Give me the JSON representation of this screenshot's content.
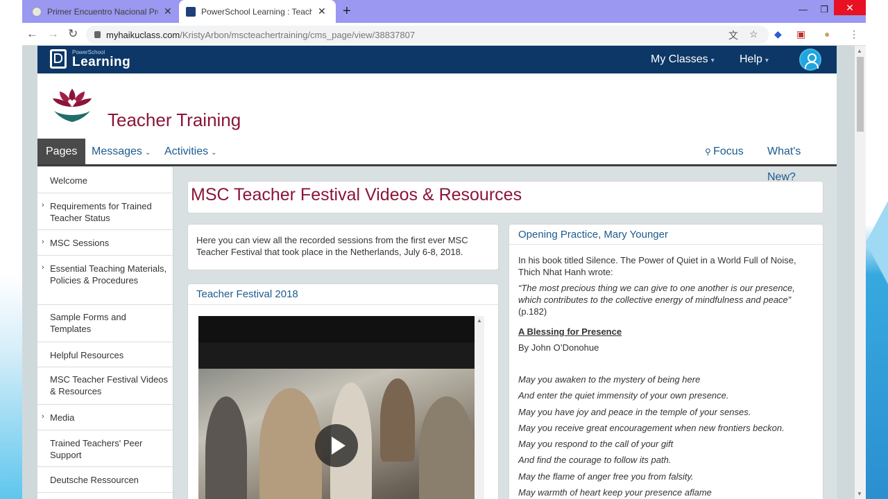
{
  "browser": {
    "tabs": [
      {
        "title": "Primer Encuentro Nacional Profe",
        "active": false
      },
      {
        "title": "PowerSchool Learning : Teacher",
        "active": true
      }
    ],
    "url_host": "myhaikuclass.com",
    "url_path": "/KristyArbon/mscteachertraining/cms_page/view/38837807"
  },
  "ps_header": {
    "logo_small": "PowerSchool",
    "logo_big": "Learning",
    "menu_my_classes": "My Classes",
    "menu_help": "Help"
  },
  "class": {
    "title": "Teacher Training"
  },
  "nav": {
    "pages": "Pages",
    "messages": "Messages",
    "activities": "Activities",
    "focus": "Focus",
    "whats_new": "What's New?"
  },
  "sidebar": {
    "items": [
      {
        "label": "Welcome",
        "expandable": false
      },
      {
        "label": "Requirements for Trained Teacher Status",
        "expandable": true
      },
      {
        "label": "MSC Sessions",
        "expandable": true
      },
      {
        "label": "Essential Teaching Materials, Policies & Procedures",
        "expandable": true
      },
      {
        "label": "Sample Forms and Templates",
        "expandable": false
      },
      {
        "label": "Helpful Resources",
        "expandable": false
      },
      {
        "label": "MSC Teacher Festival Videos & Resources",
        "expandable": false
      },
      {
        "label": "Media",
        "expandable": true
      },
      {
        "label": "Trained Teachers' Peer Support",
        "expandable": false
      },
      {
        "label": "Deutsche Ressourcen",
        "expandable": false
      }
    ]
  },
  "main": {
    "page_title": "MSC Teacher Festival Videos & Resources",
    "intro": "Here you can view all the recorded sessions from the first ever MSC Teacher Festival that took place in the Netherlands, July 6-8, 2018.",
    "video_card_title": "Teacher Festival 2018"
  },
  "poem": {
    "card_title": "Opening Practice, Mary Younger",
    "intro": "In his book titled Silence. The Power of Quiet in a World Full of Noise, Thich Nhat Hanh wrote:",
    "quote": "“The most precious thing we can give to one another is our presence, which contributes to the collective energy of mindfulness and peace”",
    "quote_cite": " (p.182)",
    "blessing_title": "A Blessing for Presence",
    "author": "By John O’Donohue",
    "lines": [
      "May you awaken to the mystery of being here",
      "And enter the quiet immensity of your own presence.",
      "May you have joy and peace in the temple of your senses.",
      "May you receive great encouragement when new frontiers beckon.",
      "May you respond to the call of your gift",
      "And find the courage to follow its path.",
      "May the flame of anger free you from falsity.",
      "May warmth of heart keep your presence aflame"
    ]
  },
  "colors": {
    "header_navy": "#0d3766",
    "title_maroon": "#8b1538",
    "link_blue": "#1c5a8c",
    "tabstrip_purple": "#9a98f0"
  },
  "icons": [
    "back-icon",
    "forward-icon",
    "reload-icon",
    "lock-icon",
    "translate-icon",
    "star-icon",
    "play-icon",
    "search-icon",
    "user-icon",
    "lotus-logo"
  ]
}
